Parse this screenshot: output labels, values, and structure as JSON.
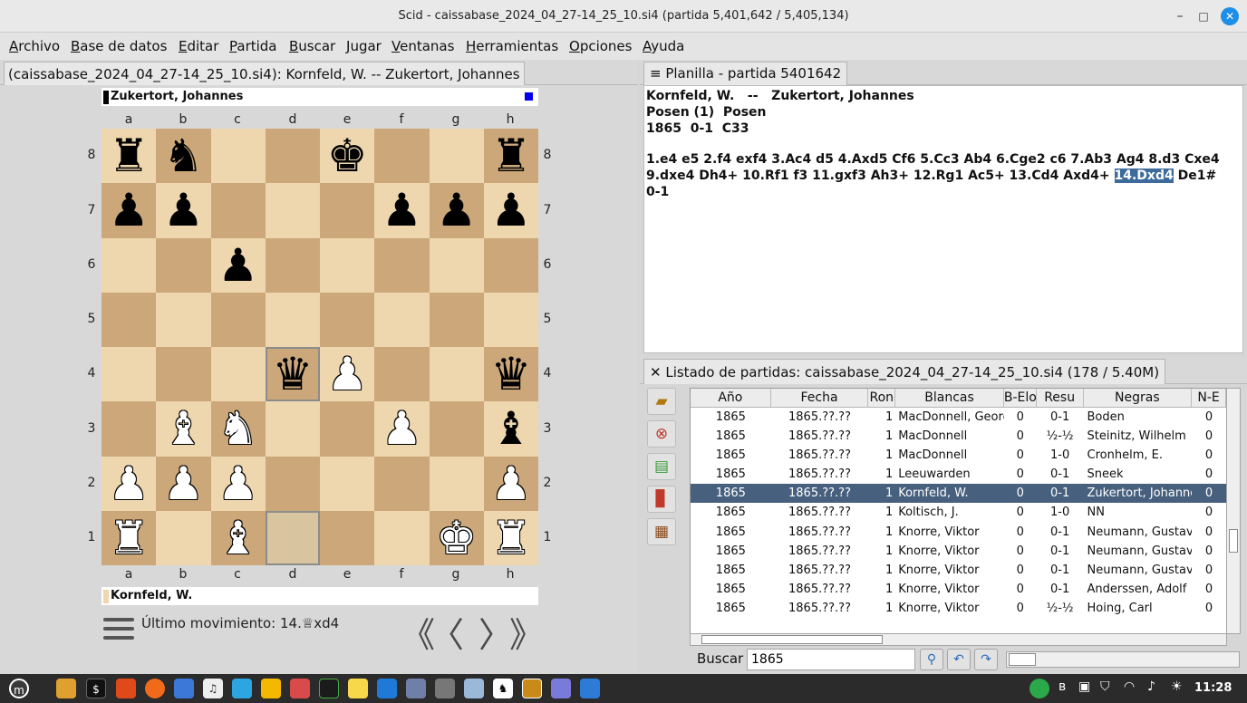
{
  "window": {
    "title": "Scid - caissabase_2024_04_27-14_25_10.si4 (partida 5,401,642 / 5,405,134)",
    "btn_min": "–",
    "btn_max": "□",
    "btn_close": "✕"
  },
  "menu": [
    "Archivo",
    "Base de datos",
    "Editar",
    "Partida",
    "Buscar",
    "Jugar",
    "Ventanas",
    "Herramientas",
    "Opciones",
    "Ayuda"
  ],
  "board_pane": {
    "tab_label": "(caissabase_2024_04_27-14_25_10.si4): Kornfeld, W. -- Zukertort, Johannes",
    "top_player": "Zukertort, Johannes",
    "bottom_player": "Kornfeld, W.",
    "files": [
      "a",
      "b",
      "c",
      "d",
      "e",
      "f",
      "g",
      "h"
    ],
    "ranks": [
      "8",
      "7",
      "6",
      "5",
      "4",
      "3",
      "2",
      "1"
    ],
    "position": [
      [
        "♜",
        "♞",
        "",
        "",
        "♚",
        "",
        "",
        "♜"
      ],
      [
        "♟",
        "♟",
        "",
        "",
        "",
        "♟",
        "♟",
        "♟"
      ],
      [
        "",
        "",
        "♟",
        "",
        "",
        "",
        "",
        ""
      ],
      [
        "",
        "",
        "",
        "",
        "",
        "",
        "",
        ""
      ],
      [
        "",
        "",
        "",
        "♛",
        "♙",
        "",
        "",
        "♛"
      ],
      [
        "",
        "♗",
        "♘",
        "",
        "",
        "♙",
        "",
        "♝"
      ],
      [
        "♙",
        "♙",
        "♙",
        "",
        "",
        "",
        "",
        "♙"
      ],
      [
        "♖",
        "",
        "♗",
        "",
        "",
        "",
        "♔",
        "♖"
      ]
    ],
    "last_move_label": "Último movimiento: 14.♕xd4",
    "nav": {
      "start": "《",
      "prev": "〈",
      "next": "〉",
      "end": "》"
    }
  },
  "planilla": {
    "tab_label": "Planilla - partida 5401642",
    "header_line1": "Kornfeld, W.   --   Zukertort, Johannes",
    "header_line2": "Posen (1)  Posen",
    "header_line3": "1865  0-1  C33",
    "moves_line1": "1.e4 e5 2.f4 exf4 3.Ac4 d5 4.Axd5 Cf6 5.Cc3 Ab4 6.Cge2 c6 7.Ab3 Ag4 8.d3 Cxe4",
    "moves_line2_a": "9.dxe4 Dh4+ 10.Rf1 f3 11.gxf3 Ah3+ 12.Rg1 Ac5+ 13.Cd4 Axd4+ ",
    "moves_line2_current": "14.Dxd4",
    "moves_line2_b": " De1#",
    "result": "0-1"
  },
  "gamelist": {
    "tab_label": "Listado de partidas: caissabase_2024_04_27-14_25_10.si4 (178 / 5.40M)",
    "columns": [
      "Año",
      "Fecha",
      "Ron",
      "Blancas",
      "B-Elo",
      "Resu",
      "Negras",
      "N-E"
    ],
    "rows": [
      [
        "1865",
        "1865.??.??",
        "1",
        "MacDonnell, Georg",
        "0",
        "0-1",
        "Boden",
        "0"
      ],
      [
        "1865",
        "1865.??.??",
        "1",
        "MacDonnell",
        "0",
        "½-½",
        "Steinitz, Wilhelm",
        "0"
      ],
      [
        "1865",
        "1865.??.??",
        "1",
        "MacDonnell",
        "0",
        "1-0",
        "Cronhelm, E.",
        "0"
      ],
      [
        "1865",
        "1865.??.??",
        "1",
        "Leeuwarden",
        "0",
        "0-1",
        "Sneek",
        "0"
      ],
      [
        "1865",
        "1865.??.??",
        "1",
        "Kornfeld, W.",
        "0",
        "0-1",
        "Zukertort, Johanne",
        "0"
      ],
      [
        "1865",
        "1865.??.??",
        "1",
        "Koltisch, J.",
        "0",
        "1-0",
        "NN",
        "0"
      ],
      [
        "1865",
        "1865.??.??",
        "1",
        "Knorre, Viktor",
        "0",
        "0-1",
        "Neumann, Gustav",
        "0"
      ],
      [
        "1865",
        "1865.??.??",
        "1",
        "Knorre, Viktor",
        "0",
        "0-1",
        "Neumann, Gustav",
        "0"
      ],
      [
        "1865",
        "1865.??.??",
        "1",
        "Knorre, Viktor",
        "0",
        "0-1",
        "Neumann, Gustav",
        "0"
      ],
      [
        "1865",
        "1865.??.??",
        "1",
        "Knorre, Viktor",
        "0",
        "0-1",
        "Anderssen, Adolf",
        "0"
      ],
      [
        "1865",
        "1865.??.??",
        "1",
        "Knorre, Viktor",
        "0",
        "½-½",
        "Hoing, Carl",
        "0"
      ]
    ],
    "selected_row": 4,
    "search_label": "Buscar",
    "search_value": "1865"
  },
  "taskbar": {
    "clock": "11:28"
  },
  "colors": {
    "selection": "#47607e",
    "current_move": "#3d6b9b",
    "light_square": "#eed7ae",
    "dark_square": "#cba77a"
  }
}
